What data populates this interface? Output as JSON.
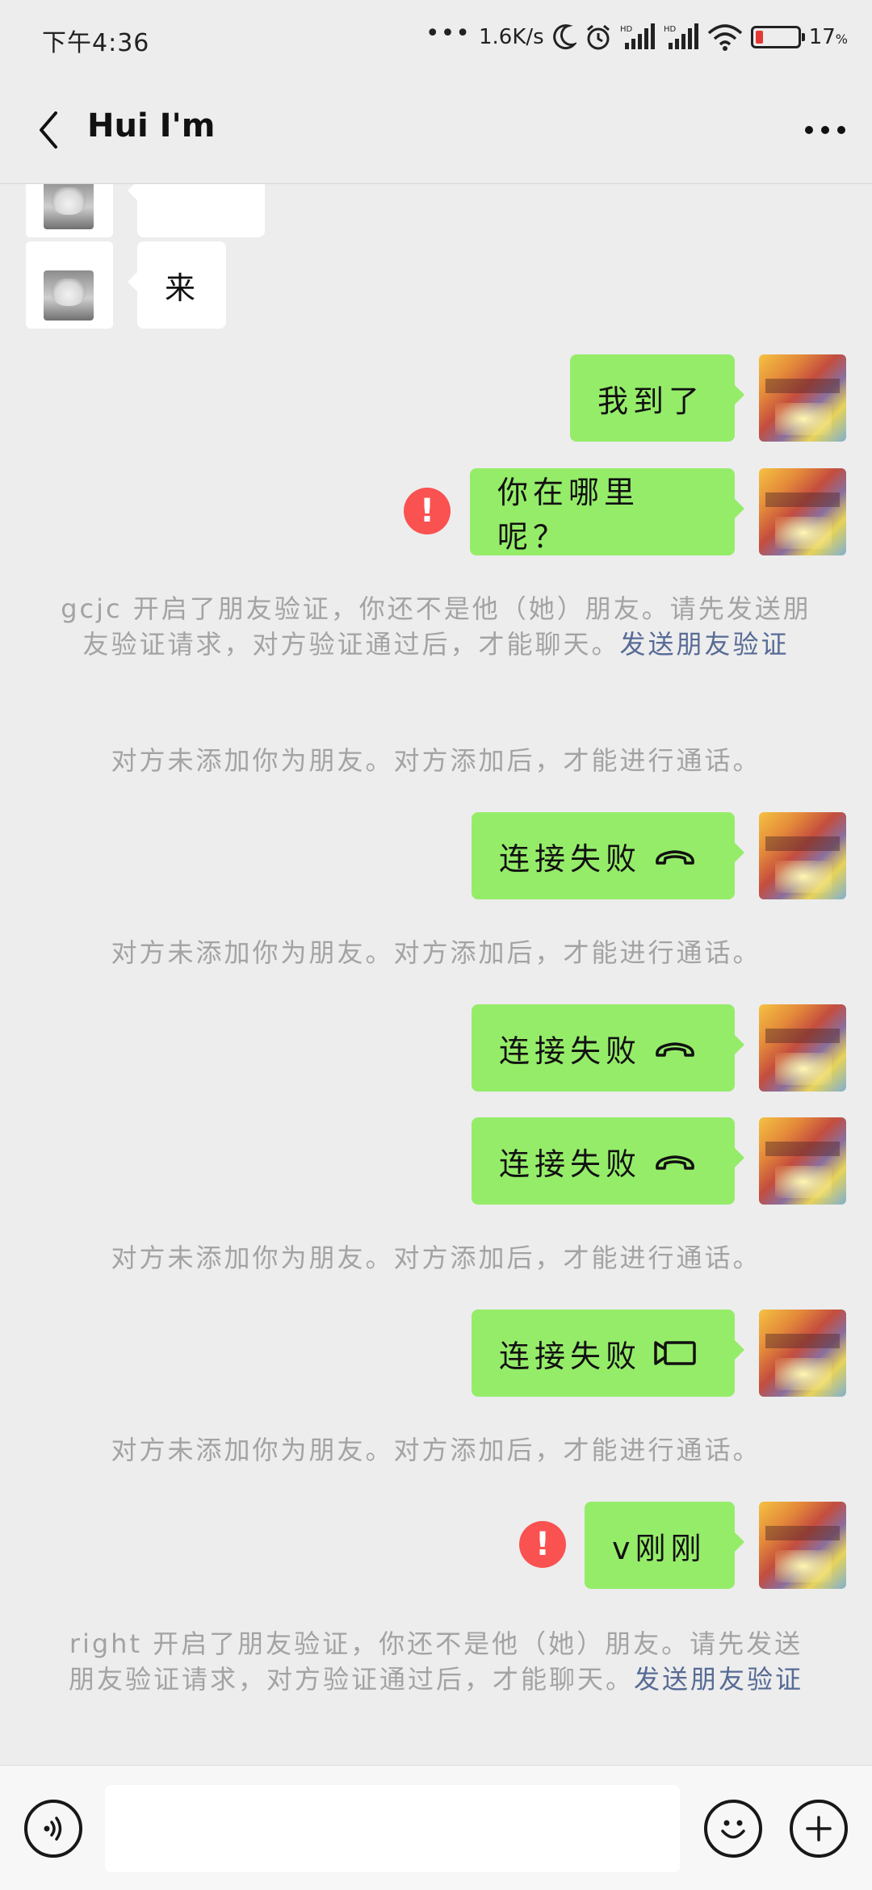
{
  "status_bar": {
    "time": "下午4:36",
    "net_speed": "1.6K/s",
    "battery_pct": "17",
    "battery_unit": "%",
    "battery_level": 0.17,
    "battery_color": "#e53935"
  },
  "header": {
    "title": "Hui I'm",
    "back_icon": "chevron-left-icon",
    "more_icon": "more-dots-icon"
  },
  "messages": {
    "partial_left_text": "",
    "msg1": "来",
    "msg2": "我到了",
    "msg3": "你在哪里呢？",
    "sys1_text": "gcjc 开启了朋友验证，你还不是他（她）朋友。请先发送朋友验证请求，对方验证通过后，才能聊天。",
    "sys1_link": "发送朋友验证",
    "sys2": "对方未添加你为朋友。对方添加后，才能进行通话。",
    "call1": "连接失败",
    "sys3": "对方未添加你为朋友。对方添加后，才能进行通话。",
    "call2": "连接失败",
    "call3": "连接失败",
    "sys4": "对方未添加你为朋友。对方添加后，才能进行通话。",
    "call4": "连接失败",
    "sys5": "对方未添加你为朋友。对方添加后，才能进行通话。",
    "msg4": "v刚刚",
    "sys6_text": "right 开启了朋友验证，你还不是他（她）朋友。请先发送朋友验证请求，对方验证通过后，才能聊天。",
    "sys6_link": "发送朋友验证",
    "error_mark": "!"
  },
  "colors": {
    "background": "#ededed",
    "bubble_self": "#95ec69",
    "bubble_other": "#ffffff",
    "error": "#fa5151",
    "link": "#576b95",
    "system_text": "#a3a3a3"
  },
  "bottom_bar": {
    "voice_icon": "voice-icon",
    "emoji_icon": "emoji-icon",
    "plus_icon": "plus-icon",
    "input_value": ""
  }
}
